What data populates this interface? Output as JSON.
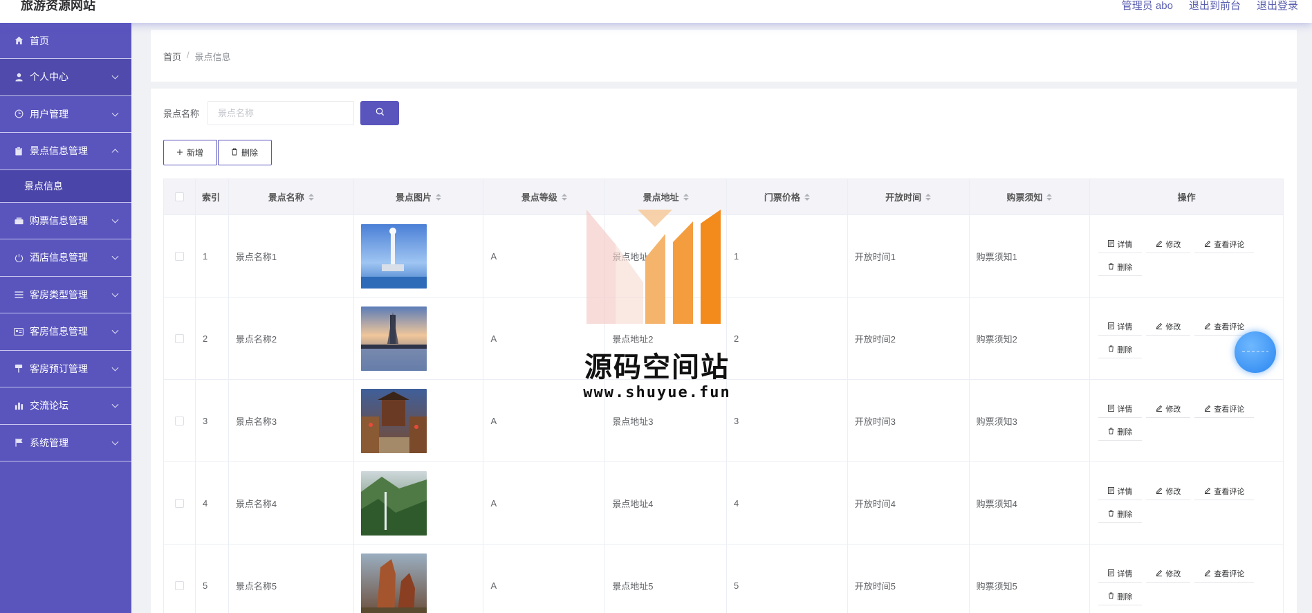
{
  "header": {
    "site_title": "旅游资源网站",
    "admin_label": "管理员 abo",
    "frontend_link": "退出到前台",
    "logout_link": "退出登录"
  },
  "sidebar": {
    "items": [
      {
        "label": "首页",
        "icon": "home-icon"
      },
      {
        "label": "个人中心",
        "icon": "user-icon"
      },
      {
        "label": "用户管理",
        "icon": "clock-icon"
      },
      {
        "label": "景点信息管理",
        "icon": "clipboard-icon"
      },
      {
        "label": "购票信息管理",
        "icon": "ticket-icon"
      },
      {
        "label": "酒店信息管理",
        "icon": "power-icon"
      },
      {
        "label": "客房类型管理",
        "icon": "list-icon"
      },
      {
        "label": "客房信息管理",
        "icon": "card-icon"
      },
      {
        "label": "客房预订管理",
        "icon": "sign-icon"
      },
      {
        "label": "交流论坛",
        "icon": "chart-icon"
      },
      {
        "label": "系统管理",
        "icon": "flag-icon"
      }
    ],
    "sub_item": "景点信息"
  },
  "breadcrumb": {
    "home": "首页",
    "separator": "/",
    "current": "景点信息"
  },
  "search": {
    "label": "景点名称",
    "placeholder": "景点名称"
  },
  "actions": {
    "add_label": "新增",
    "delete_label": "删除"
  },
  "table": {
    "columns": [
      "索引",
      "景点名称",
      "景点图片",
      "景点等级",
      "景点地址",
      "门票价格",
      "开放时间",
      "购票须知",
      "操作"
    ],
    "rows": [
      {
        "index": "1",
        "name": "景点名称1",
        "level": "A",
        "address": "景点地址1",
        "price": "1",
        "open_time": "开放时间1",
        "notice": "购票须知1"
      },
      {
        "index": "2",
        "name": "景点名称2",
        "level": "A",
        "address": "景点地址2",
        "price": "2",
        "open_time": "开放时间2",
        "notice": "购票须知2"
      },
      {
        "index": "3",
        "name": "景点名称3",
        "level": "A",
        "address": "景点地址3",
        "price": "3",
        "open_time": "开放时间3",
        "notice": "购票须知3"
      },
      {
        "index": "4",
        "name": "景点名称4",
        "level": "A",
        "address": "景点地址4",
        "price": "4",
        "open_time": "开放时间4",
        "notice": "购票须知4"
      },
      {
        "index": "5",
        "name": "景点名称5",
        "level": "A",
        "address": "景点地址5",
        "price": "5",
        "open_time": "开放时间5",
        "notice": "购票须知5"
      }
    ],
    "op_labels": {
      "detail": "详情",
      "edit": "修改",
      "comments": "查看评论",
      "delete": "删除"
    }
  },
  "watermark": {
    "title": "源码空间站",
    "url": "www.shuyue.fun"
  },
  "colors": {
    "primary": "#5a55bd",
    "sidebar_bg": "#5a55bd",
    "watermark_orange": "#f28a1c",
    "float_button": "#2a86f0"
  }
}
